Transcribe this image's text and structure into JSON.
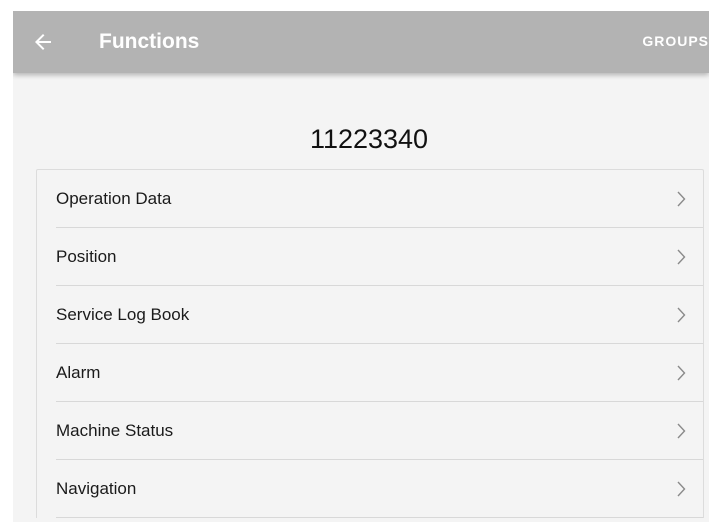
{
  "app_bar": {
    "title": "Functions",
    "action_label": "GROUPS",
    "back_icon": "arrow-left-icon",
    "background_color": "#b3b3b3",
    "text_color": "#ffffff"
  },
  "machine": {
    "id": "11223340"
  },
  "functions_list": {
    "items": [
      {
        "label": "Operation Data",
        "icon": "chevron-right-icon"
      },
      {
        "label": "Position",
        "icon": "chevron-right-icon"
      },
      {
        "label": "Service Log Book",
        "icon": "chevron-right-icon"
      },
      {
        "label": "Alarm",
        "icon": "chevron-right-icon"
      },
      {
        "label": "Machine Status",
        "icon": "chevron-right-icon"
      },
      {
        "label": "Navigation",
        "icon": "chevron-right-icon"
      }
    ]
  }
}
